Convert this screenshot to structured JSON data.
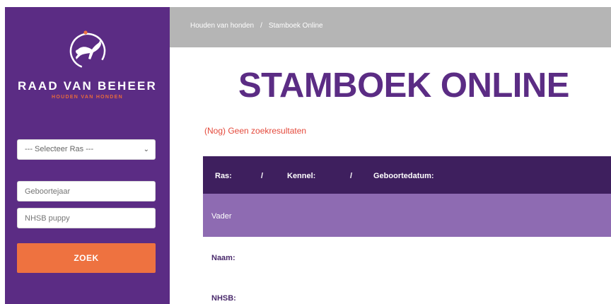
{
  "breadcrumb": {
    "home": "Houden van honden",
    "separator": "/",
    "current": "Stamboek Online"
  },
  "sidebar": {
    "brand": "RAAD VAN BEHEER",
    "tagline": "HOUDEN VAN HONDEN",
    "breed_select": "--- Selecteer Ras ---",
    "year_placeholder": "Geboortejaar",
    "puppy_placeholder": "NHSB puppy",
    "search_button": "ZOEK"
  },
  "main": {
    "title": "STAMBOEK ONLINE",
    "no_results": "(Nog) Geen zoekresultaten",
    "table": {
      "ras": "Ras:",
      "kennel": "Kennel:",
      "geboortedatum": "Geboortedatum:",
      "separator": "/",
      "vader": "Vader",
      "naam": "Naam:",
      "nhsb": "NHSB:"
    }
  },
  "colors": {
    "purple": "#5b2c84",
    "dark_purple": "#3e1f5e",
    "light_purple": "#8e6bb2",
    "orange": "#ee7240",
    "red": "#e4493b"
  }
}
